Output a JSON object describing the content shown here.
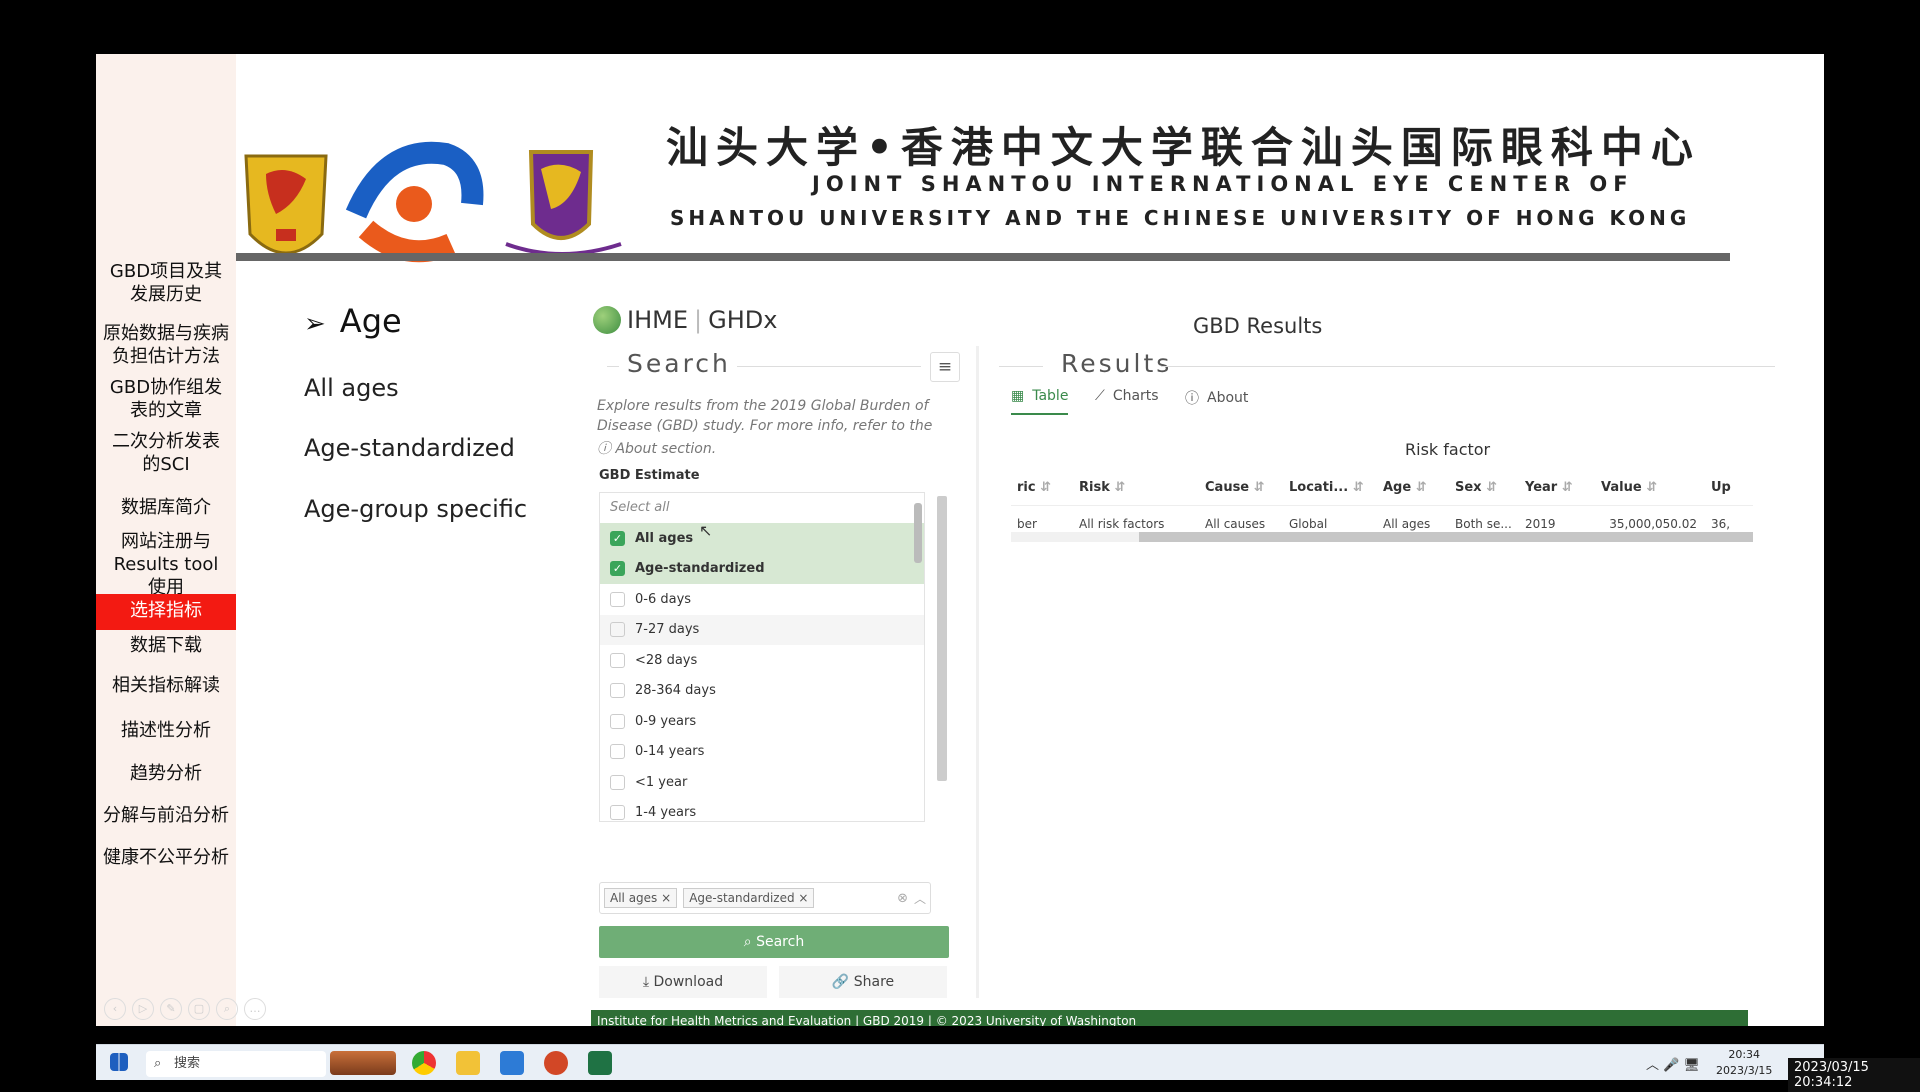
{
  "sidebar": {
    "items": [
      {
        "label": "GBD项目及其\n发展历史"
      },
      {
        "label": "原始数据与疾病\n负担估计方法"
      },
      {
        "label": "GBD协作组发\n表的文章"
      },
      {
        "label": "二次分析发表\n的SCI"
      },
      {
        "label": "数据库简介"
      },
      {
        "label": "网站注册与\nResults tool\n使用"
      },
      {
        "label": "选择指标"
      },
      {
        "label": "数据下载"
      },
      {
        "label": "相关指标解读"
      },
      {
        "label": "描述性分析"
      },
      {
        "label": "趋势分析"
      },
      {
        "label": "分解与前沿分析"
      },
      {
        "label": "健康不公平分析"
      }
    ],
    "active_index": 6,
    "active_color": "#f31a12"
  },
  "header": {
    "title_cn": "汕头大学•香港中文大学联合汕头国际眼科中心",
    "title_en_line1": "JOINT SHANTOU INTERNATIONAL EYE CENTER OF",
    "title_en_line2": "SHANTOU UNIVERSITY AND THE CHINESE UNIVERSITY OF HONG KONG"
  },
  "content": {
    "heading": "Age",
    "bullet": "➢",
    "items": [
      "All ages",
      "Age-standardized",
      "Age-group specific"
    ]
  },
  "app": {
    "brand_left": "IHME",
    "brand_right": "GHDx",
    "page_title": "GBD Results",
    "search_panel": {
      "title": "Search",
      "description": "Explore results from the 2019 Global Burden of Disease (GBD) study. For more info, refer to the",
      "about_link": "About section.",
      "estimate_label": "GBD Estimate",
      "select_all": "Select all",
      "options": [
        {
          "label": "All ages",
          "checked": true
        },
        {
          "label": "Age-standardized",
          "checked": true
        },
        {
          "label": "0-6 days",
          "checked": false
        },
        {
          "label": "7-27 days",
          "checked": false
        },
        {
          "label": "<28 days",
          "checked": false
        },
        {
          "label": "28-364 days",
          "checked": false
        },
        {
          "label": "0-9 years",
          "checked": false
        },
        {
          "label": "0-14 years",
          "checked": false
        },
        {
          "label": "<1 year",
          "checked": false
        },
        {
          "label": "1-4 years",
          "checked": false
        }
      ],
      "selected_tags": [
        "All ages",
        "Age-standardized"
      ],
      "search_button": "Search",
      "download_button": "Download",
      "share_button": "Share",
      "accent_color": "#6fae76"
    },
    "results_panel": {
      "title": "Results",
      "tabs": [
        {
          "label": "Table",
          "icon": "table-icon",
          "active": true
        },
        {
          "label": "Charts",
          "icon": "line-chart-icon",
          "active": false
        },
        {
          "label": "About",
          "icon": "info-icon",
          "active": false
        }
      ],
      "table_title": "Risk factor",
      "columns": [
        "ric",
        "Risk",
        "Cause",
        "Locati...",
        "Age",
        "Sex",
        "Year",
        "Value",
        "Up"
      ],
      "rows": [
        [
          "ber",
          "All risk factors",
          "All causes",
          "Global",
          "All ages",
          "Both se...",
          "2019",
          "35,000,050.02",
          "36,"
        ]
      ]
    },
    "footer": "Institute for Health Metrics and Evaluation  |  GBD 2019  |  © 2023 University of Washington"
  },
  "taskbar": {
    "search_placeholder": "搜索",
    "time": "20:34",
    "date": "2023/3/15"
  },
  "timestamp": "2023/03/15 20:34:12"
}
